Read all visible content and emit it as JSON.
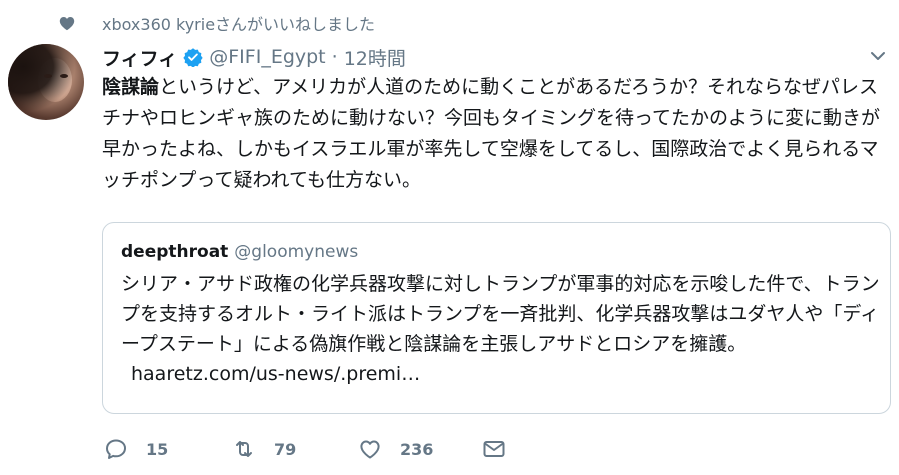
{
  "social_context": {
    "text": "xbox360 kyrieさんがいいねしました",
    "icon": "heart-icon"
  },
  "tweet": {
    "author_name": "フィフィ",
    "verified": true,
    "handle": "@FIFI_Egypt",
    "separator": "·",
    "time": "12時間",
    "text_bold": "陰謀論",
    "text_rest": "というけど、アメリカが人道のために動くことがあるだろうか？それならなぜパレスチナやロヒンギャ族のために動けない？今回もタイミングを待ってたかのように変に動きが早かったよね、しかもイスラエル軍が率先して空爆をしてるし、国際政治でよく見られるマッチポンプって疑われても仕方ない。"
  },
  "quoted_tweet": {
    "author_name": "deepthroat",
    "handle": "@gloomynews",
    "text": "シリア・アサド政権の化学兵器攻撃に対しトランプが軍事的対応を示唆した件で、トランプを支持するオルト・ライト派はトランプを一斉批判、化学兵器攻撃はユダヤ人や「ディープステート」による偽旗作戦と陰謀論を主張しアサドとロシアを擁護。",
    "link": "haaretz.com/us-news/.premi…"
  },
  "actions": {
    "reply_count": "15",
    "retweet_count": "79",
    "like_count": "236"
  },
  "colors": {
    "text": "#14171a",
    "secondary": "#657786",
    "verified": "#1da1f2",
    "border": "#ccd6dd"
  }
}
